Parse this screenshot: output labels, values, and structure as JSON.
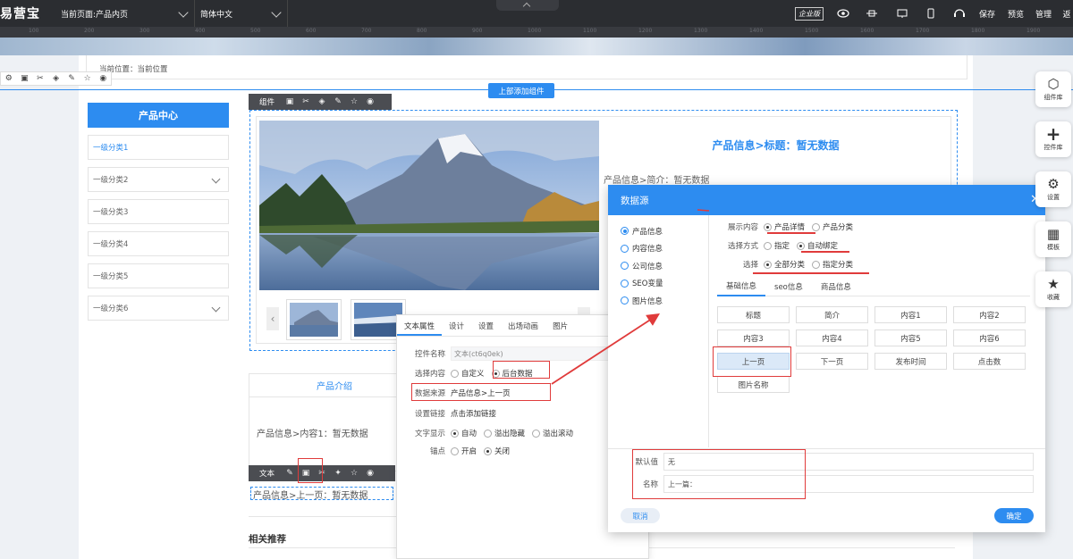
{
  "topbar": {
    "logo": "易营宝",
    "page_select": "当前页面:产品内页",
    "lang_select": "简体中文",
    "enterprise_badge": "企业版",
    "save": "保存",
    "preview": "预览",
    "manage": "管理",
    "exit": "返"
  },
  "ruler": [
    "100",
    "200",
    "300",
    "400",
    "500",
    "600",
    "700",
    "800",
    "900",
    "1000",
    "1100",
    "1200",
    "1300",
    "1400",
    "1500",
    "1600",
    "1700",
    "1800",
    "1900"
  ],
  "breadcrumb": "当前位置：当前位置",
  "add_top_component": "上部添加组件",
  "component_bar_label": "组件",
  "sidebar": {
    "title": "产品中心",
    "items": [
      "一级分类1",
      "一级分类2",
      "一级分类3",
      "一级分类4",
      "一级分类5",
      "一级分类6"
    ]
  },
  "product": {
    "title": "产品信息>标题：暂无数据",
    "brief": "产品信息>简介：暂无数据",
    "intro_heading": "产品介绍",
    "intro_text": "产品信息>内容1：暂无数据",
    "prev_text": "产品信息>上一页：暂无数据",
    "related": "相关推荐"
  },
  "text_bar_label": "文本",
  "props_panel": {
    "tabs": [
      "文本属性",
      "设计",
      "设置",
      "出场动画",
      "图片"
    ],
    "name_label": "控件名称",
    "name_value": "文本(ct6q0ek)",
    "select_label": "选择内容",
    "opt_custom": "自定义",
    "opt_backend": "后台数据",
    "source_label": "数据来源",
    "source_value": "产品信息>上一页",
    "link_label": "设置链接",
    "link_value": "点击添加链接",
    "display_label": "文字显示",
    "disp_auto": "自动",
    "disp_hide": "溢出隐藏",
    "disp_scroll": "溢出滚动",
    "anchor_label": "锚点",
    "anchor_on": "开启",
    "anchor_off": "关闭"
  },
  "datasource": {
    "title": "数据源",
    "left": [
      "产品信息",
      "内容信息",
      "公司信息",
      "SEO变量",
      "图片信息"
    ],
    "show_label": "展示内容",
    "show_detail": "产品详情",
    "show_cat": "产品分类",
    "mode_label": "选择方式",
    "mode_specify": "指定",
    "mode_auto": "自动绑定",
    "select_label": "选择",
    "sel_all": "全部分类",
    "sel_specify": "指定分类",
    "subtabs": [
      "基础信息",
      "seo信息",
      "商品信息"
    ],
    "fields": [
      "标题",
      "简介",
      "内容1",
      "内容2",
      "内容3",
      "内容4",
      "内容5",
      "内容6",
      "上一页",
      "下一页",
      "发布时间",
      "点击数",
      "图片名称"
    ],
    "default_label": "默认值",
    "default_value": "无",
    "name_label": "名称",
    "name_value": "上一篇：",
    "cancel": "取消",
    "ok": "确定"
  },
  "right_panel": [
    "组件库",
    "控件库",
    "设置",
    "模板",
    "收藏"
  ],
  "colors": {
    "accent": "#2d8cf0",
    "annotation": "#e03b3b",
    "topbar": "#2b2d31"
  }
}
